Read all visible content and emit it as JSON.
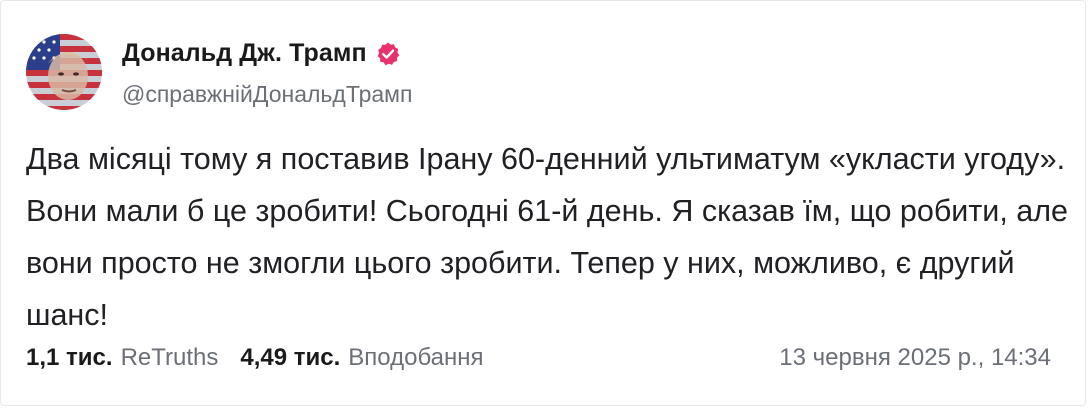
{
  "post": {
    "author_name": "Дональд Дж. Трамп",
    "author_handle": "@справжнійДональдТрамп",
    "verified": true,
    "text": "Два місяці тому я поставив Ірану 60-денний ультиматум «укласти угоду». Вони мали б це зробити! Сьогодні 61-й день. Я сказав їм, що робити, але вони просто не змогли цього зробити. Тепер у них, можливо, є другий шанс!",
    "retruths_count": "1,1 тис.",
    "retruths_label": "ReTruths",
    "likes_count": "4,49 тис.",
    "likes_label": "Вподобання",
    "timestamp": "13 червня 2025 р., 14:34"
  },
  "icons": {
    "avatar": "avatar-image",
    "verified": "verified-badge-icon"
  },
  "colors": {
    "verified_badge": "#e8326b",
    "muted_text": "#6b6f76",
    "primary_text": "#1a1a1a"
  }
}
